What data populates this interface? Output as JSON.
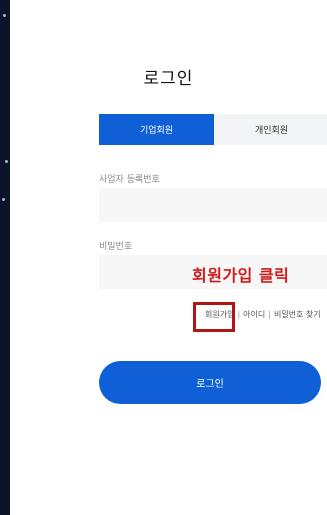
{
  "title": "로그인",
  "tabs": [
    {
      "label": "기업회원",
      "active": true
    },
    {
      "label": "개인회원",
      "active": false
    }
  ],
  "fields": {
    "business_number": {
      "label": "사업자 등록번호",
      "value": "",
      "placeholder": ""
    },
    "password": {
      "label": "비밀번호",
      "value": "",
      "placeholder": ""
    }
  },
  "annotation": "회원가입 클릭",
  "links": {
    "signup": "회원가입",
    "separator": "|",
    "find_id": "아이디",
    "find_password": "비밀번호 찾기"
  },
  "login_button": "로그인",
  "colors": {
    "primary": "#0f5fd6",
    "annotation_red": "#d11a1a",
    "highlight_box": "#b01616"
  }
}
